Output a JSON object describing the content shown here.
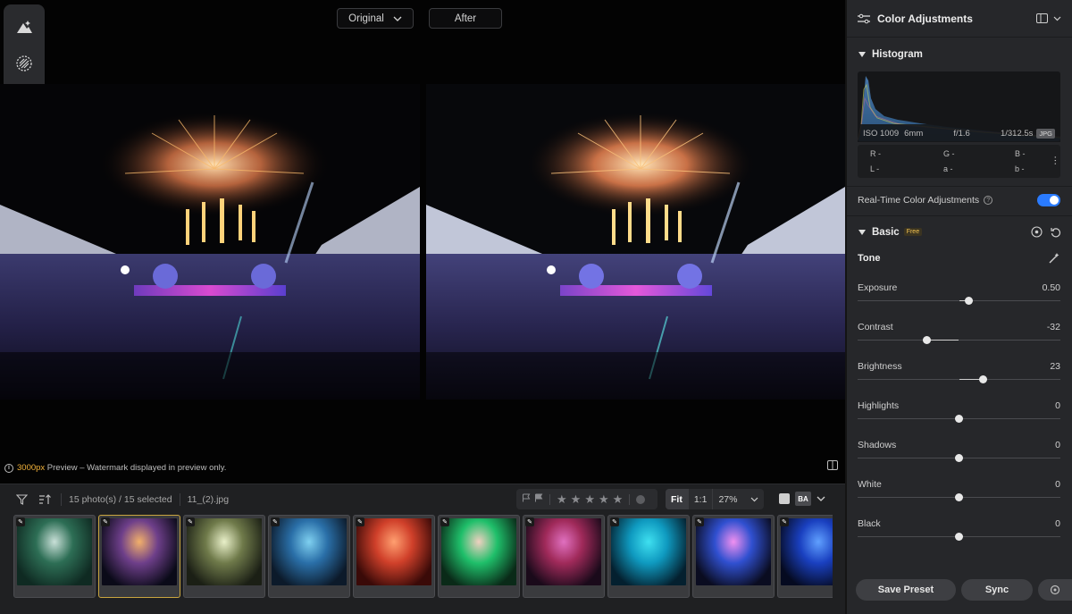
{
  "compare": {
    "original_label": "Original",
    "after_label": "After"
  },
  "preview_note": {
    "highlight": "3000px",
    "rest": " Preview – Watermark displayed in preview only."
  },
  "filmstrip": {
    "selection_text": "15 photo(s) / 15 selected",
    "filename": "11_(2).jpg",
    "zoom": {
      "fit": "Fit",
      "one_to_one": "1:1",
      "percent": "27%"
    },
    "view_ba": "BA",
    "thumbnails": [
      {
        "name": "thumb-1",
        "selected": false
      },
      {
        "name": "thumb-2",
        "selected": true
      },
      {
        "name": "thumb-3",
        "selected": false
      },
      {
        "name": "thumb-4",
        "selected": false
      },
      {
        "name": "thumb-5",
        "selected": false
      },
      {
        "name": "thumb-6",
        "selected": false
      },
      {
        "name": "thumb-7",
        "selected": false
      },
      {
        "name": "thumb-8",
        "selected": false
      },
      {
        "name": "thumb-9",
        "selected": false
      },
      {
        "name": "thumb-10",
        "selected": false
      }
    ]
  },
  "panel": {
    "title": "Color Adjustments",
    "histogram": {
      "title": "Histogram",
      "iso": "ISO 1009",
      "focal": "6mm",
      "aperture": "f/1.6",
      "shutter": "1/312.5s",
      "format": "JPG",
      "r": "R -",
      "g": "G -",
      "b": "B -",
      "l": "L -",
      "a": "a -",
      "b2": "b -"
    },
    "realtime_label": "Real-Time Color Adjustments",
    "basic_title": "Basic",
    "basic_badge": "Free",
    "tone_title": "Tone",
    "sliders": [
      {
        "label": "Exposure",
        "value": "0.50",
        "pos": 0.55
      },
      {
        "label": "Contrast",
        "value": "-32",
        "pos": 0.34
      },
      {
        "label": "Brightness",
        "value": "23",
        "pos": 0.62
      },
      {
        "label": "Highlights",
        "value": "0",
        "pos": 0.5
      },
      {
        "label": "Shadows",
        "value": "0",
        "pos": 0.5
      },
      {
        "label": "White",
        "value": "0",
        "pos": 0.5
      },
      {
        "label": "Black",
        "value": "0",
        "pos": 0.5
      }
    ],
    "save_preset": "Save Preset",
    "sync": "Sync"
  },
  "colors": {
    "accent": "#2a7bff",
    "highlight": "#f2b23a",
    "selected_thumb": "#c9a53f"
  }
}
